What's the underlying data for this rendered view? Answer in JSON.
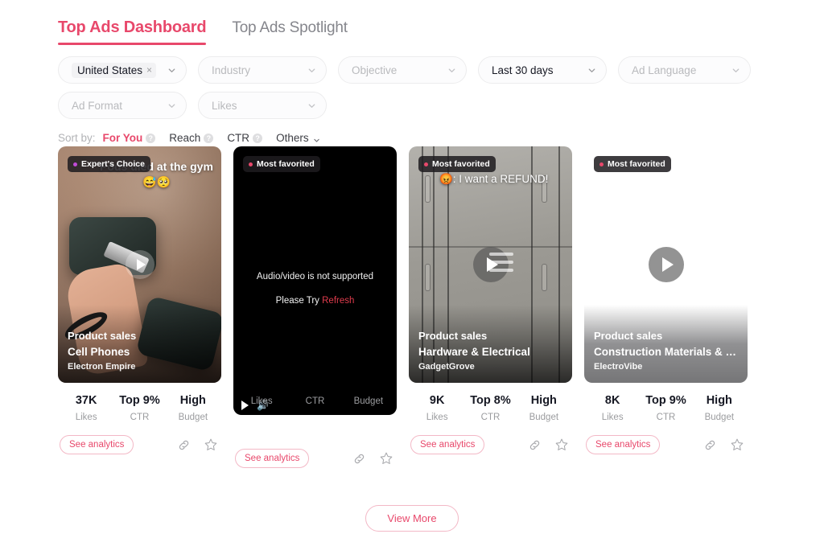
{
  "tabs": [
    {
      "label": "Top Ads Dashboard",
      "active": true
    },
    {
      "label": "Top Ads Spotlight",
      "active": false
    }
  ],
  "filters": {
    "row1": [
      {
        "name": "country",
        "chip": "United States",
        "chip_remove": "×",
        "placeholder": ""
      },
      {
        "name": "industry",
        "placeholder": "Industry"
      },
      {
        "name": "objective",
        "placeholder": "Objective"
      },
      {
        "name": "date",
        "value": "Last 30 days"
      },
      {
        "name": "language",
        "placeholder": "Ad Language"
      }
    ],
    "row2": [
      {
        "name": "ad-format",
        "placeholder": "Ad Format"
      },
      {
        "name": "likes",
        "placeholder": "Likes"
      }
    ]
  },
  "sort": {
    "label": "Sort by:",
    "options": [
      {
        "label": "For You",
        "active": true,
        "help": "?"
      },
      {
        "label": "Reach",
        "active": false,
        "help": "?"
      },
      {
        "label": "CTR",
        "active": false,
        "help": "?"
      },
      {
        "label": "Others",
        "active": false,
        "caret": true
      }
    ]
  },
  "colors": {
    "accent": "#e8486b",
    "badge_dot_expert": "#c04bd6",
    "badge_dot_favorite": "#e8486b",
    "refresh_link": "#e03c4d"
  },
  "cards": [
    {
      "badge": {
        "text": "Expert's Choice",
        "dot": "expert"
      },
      "overlay_text": "Pods died at the gym😅🥺",
      "objective": "Product sales",
      "industry": "Cell Phones",
      "brand": "Electron Empire",
      "stats": [
        {
          "value": "37K",
          "key": "Likes"
        },
        {
          "value": "Top 9%",
          "key": "CTR"
        },
        {
          "value": "High",
          "key": "Budget"
        }
      ],
      "see_analytics": "See analytics",
      "icons": [
        "link-icon",
        "star-icon"
      ]
    },
    {
      "badge": {
        "text": "Most favorited",
        "dot": "favorite"
      },
      "error_line1": "Audio/video is not supported",
      "error_line2_prefix": "Please Try ",
      "error_line2_link": "Refresh",
      "objective": "",
      "industry": "",
      "brand": "",
      "stats": [
        {
          "value": "",
          "key": "Likes"
        },
        {
          "value": "",
          "key": "CTR"
        },
        {
          "value": "",
          "key": "Budget"
        }
      ],
      "see_analytics": "See analytics",
      "icons": [
        "link-icon",
        "star-icon"
      ]
    },
    {
      "badge": {
        "text": "Most favorited",
        "dot": "favorite"
      },
      "overlay_text": "😡: I want a REFUND!",
      "objective": "Product sales",
      "industry": "Hardware & Electrical",
      "brand": "GadgetGrove",
      "stats": [
        {
          "value": "9K",
          "key": "Likes"
        },
        {
          "value": "Top 8%",
          "key": "CTR"
        },
        {
          "value": "High",
          "key": "Budget"
        }
      ],
      "see_analytics": "See analytics",
      "icons": [
        "link-icon",
        "star-icon"
      ]
    },
    {
      "badge": {
        "text": "Most favorited",
        "dot": "favorite"
      },
      "overlay_text": "",
      "objective": "Product sales",
      "industry": "Construction Materials & L...",
      "brand": "ElectroVibe",
      "stats": [
        {
          "value": "8K",
          "key": "Likes"
        },
        {
          "value": "Top 9%",
          "key": "CTR"
        },
        {
          "value": "High",
          "key": "Budget"
        }
      ],
      "see_analytics": "See analytics",
      "icons": [
        "link-icon",
        "star-icon"
      ]
    }
  ],
  "footer": {
    "view_more": "View More"
  }
}
